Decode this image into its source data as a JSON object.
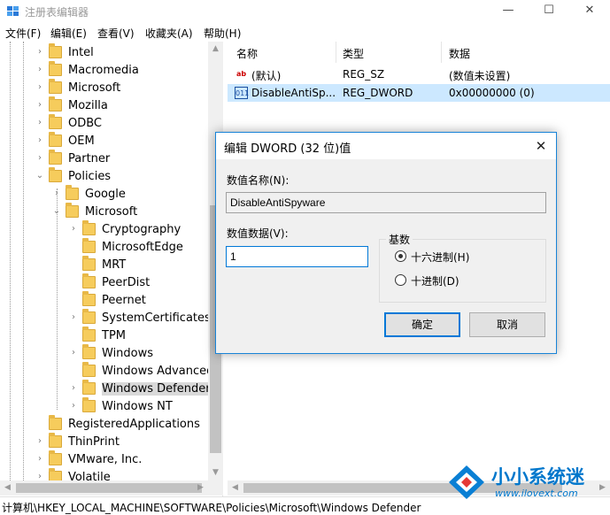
{
  "window": {
    "title": "注册表编辑器",
    "minimize": "—",
    "maximize": "☐",
    "close": "✕"
  },
  "menu": [
    "文件(F)",
    "编辑(E)",
    "查看(V)",
    "收藏夹(A)",
    "帮助(H)"
  ],
  "tree": {
    "items": [
      {
        "label": "Intel",
        "level": 2
      },
      {
        "label": "Macromedia",
        "level": 2
      },
      {
        "label": "Microsoft",
        "level": 2
      },
      {
        "label": "Mozilla",
        "level": 2
      },
      {
        "label": "ODBC",
        "level": 2
      },
      {
        "label": "OEM",
        "level": 2
      },
      {
        "label": "Partner",
        "level": 2
      },
      {
        "label": "Policies",
        "level": 2,
        "expanded": true
      },
      {
        "label": "Google",
        "level": 3
      },
      {
        "label": "Microsoft",
        "level": 3,
        "expanded": true
      },
      {
        "label": "Cryptography",
        "level": 4
      },
      {
        "label": "MicrosoftEdge",
        "level": 4,
        "leaf": true
      },
      {
        "label": "MRT",
        "level": 4,
        "leaf": true
      },
      {
        "label": "PeerDist",
        "level": 4,
        "leaf": true
      },
      {
        "label": "Peernet",
        "level": 4,
        "leaf": true
      },
      {
        "label": "SystemCertificates",
        "level": 4
      },
      {
        "label": "TPM",
        "level": 4,
        "leaf": true
      },
      {
        "label": "Windows",
        "level": 4
      },
      {
        "label": "Windows Advanced",
        "level": 4,
        "leaf": true
      },
      {
        "label": "Windows Defender",
        "level": 4,
        "selected": true
      },
      {
        "label": "Windows NT",
        "level": 4
      },
      {
        "label": "RegisteredApplications",
        "level": 2,
        "leaf": true
      },
      {
        "label": "ThinPrint",
        "level": 2
      },
      {
        "label": "VMware, Inc.",
        "level": 2
      },
      {
        "label": "Volatile",
        "level": 2
      }
    ]
  },
  "list": {
    "headers": {
      "name": "名称",
      "type": "类型",
      "data": "数据"
    },
    "rows": [
      {
        "icon": "ab",
        "name": "(默认)",
        "type": "REG_SZ",
        "data": "(数值未设置)"
      },
      {
        "icon": "011",
        "name": "DisableAntiSp...",
        "type": "REG_DWORD",
        "data": "0x00000000 (0)",
        "selected": true
      }
    ]
  },
  "status": {
    "path": "计算机\\HKEY_LOCAL_MACHINE\\SOFTWARE\\Policies\\Microsoft\\Windows Defender"
  },
  "dialog": {
    "title": "编辑 DWORD (32 位)值",
    "value_name_label": "数值名称(N):",
    "value_name": "DisableAntiSpyware",
    "value_data_label": "数值数据(V):",
    "value_data": "1",
    "base_label": "基数",
    "hex_label": "十六进制(H)",
    "dec_label": "十进制(D)",
    "base_selected": "hex",
    "ok": "确定",
    "cancel": "取消"
  },
  "watermark": {
    "brand": "小小系统迷",
    "url": "www.ilovext.com"
  },
  "colors": {
    "accent": "#0078d7",
    "selection": "#cce8ff",
    "folder": "#f6cc5c",
    "watermark_blue": "#0077cc"
  }
}
